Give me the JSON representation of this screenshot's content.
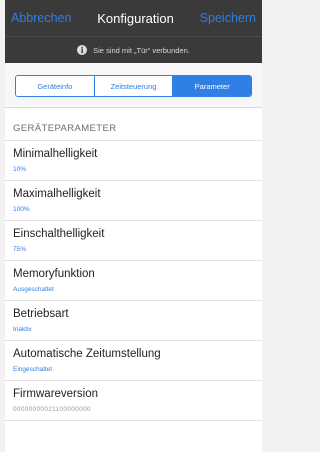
{
  "navbar": {
    "cancel_label": "Abbrechen",
    "title": "Konfiguration",
    "save_label": "Speichern"
  },
  "connection": {
    "icon": "info-icon",
    "text": "Sie sind mit „Tür“ verbunden."
  },
  "tabs": [
    {
      "label": "Geräteinfo",
      "active": false
    },
    {
      "label": "Zeitsteuerung",
      "active": false
    },
    {
      "label": "Parameter",
      "active": true
    }
  ],
  "section": {
    "header": "GERÄTEPARAMETER"
  },
  "params": [
    {
      "title": "Minimalhelligkeit",
      "value": "10%"
    },
    {
      "title": "Maximalhelligkeit",
      "value": "100%"
    },
    {
      "title": "Einschalthelligkeit",
      "value": "75%"
    },
    {
      "title": "Memoryfunktion",
      "value": "Ausgeschaltet"
    },
    {
      "title": "Betriebsart",
      "value": "Inaktiv"
    },
    {
      "title": "Automatische Zeitumstellung",
      "value": "Eingeschaltet"
    },
    {
      "title": "Firmwareversion",
      "value": "00000000021100000000"
    }
  ],
  "colors": {
    "accent": "#2f7fe5",
    "navbar_bg": "#3a3a3a"
  }
}
